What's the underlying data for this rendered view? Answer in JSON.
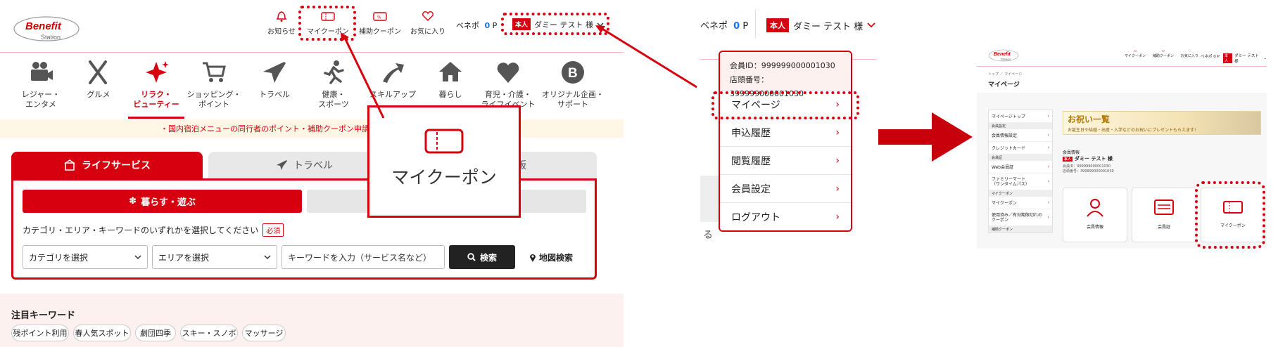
{
  "panel1": {
    "logo": {
      "line1": "Benefit",
      "line2": "Station"
    },
    "header_nav": [
      {
        "label": "お知らせ",
        "icon": "bell-icon"
      },
      {
        "label": "マイクーポン",
        "icon": "coupon-icon"
      },
      {
        "label": "補助クーポン",
        "icon": "subsidy-coupon-icon"
      },
      {
        "label": "お気に入り",
        "icon": "heart-icon"
      }
    ],
    "points_label": "ベネポ",
    "points_value": "0",
    "points_unit": "P",
    "user_badge": "本人",
    "user_name": "ダミー テスト 様",
    "categories": [
      {
        "label": "レジャー・\nエンタメ",
        "icon": "camera-icon"
      },
      {
        "label": "グルメ",
        "icon": "fork-knife-icon"
      },
      {
        "label": "リラク・\nビューティー",
        "icon": "sparkle-icon",
        "active": true
      },
      {
        "label": "ショッピング・\nポイント",
        "icon": "cart-icon"
      },
      {
        "label": "トラベル",
        "icon": "airplane-icon"
      },
      {
        "label": "健康・\nスポーツ",
        "icon": "runner-icon"
      },
      {
        "label": "スキルアップ",
        "icon": "arrow-up-icon"
      },
      {
        "label": "暮らし",
        "icon": "house-icon"
      },
      {
        "label": "育児・介護・\nライフイベント",
        "icon": "heart-fill-icon"
      },
      {
        "label": "オリジナル企画・\nサポート",
        "icon": "b-badge-icon"
      }
    ],
    "notice": "・国内宿泊メニューの同行者のポイント・補助クーポン申請締",
    "tabs": [
      {
        "label": "ライフサービス",
        "active": true
      },
      {
        "label": "トラベル"
      },
      {
        "label": "販"
      }
    ],
    "subtab_active": "暮らす・遊ぶ",
    "search_instruction": "カテゴリ・エリア・キーワードのいずれかを選択してください",
    "required_badge": "必須",
    "category_select": "カテゴリを選択",
    "area_select": "エリアを選択",
    "keyword_placeholder": "キーワードを入力（サービス名など）",
    "search_button": "検索",
    "map_search": "地図検索",
    "featured_title": "注目キーワード",
    "keywords": [
      "残ポイント利用",
      "春人気スポット",
      "劇団四季",
      "スキー・スノボ",
      "マッサージ"
    ],
    "zoom_label": "マイクーポン"
  },
  "panel2": {
    "points_label": "ベネポ",
    "points_value": "0",
    "points_unit": "P",
    "user_badge": "本人",
    "user_name": "ダミー テスト 様",
    "member_id": "会員ID：999999000001030",
    "store_number": "店頭番号：399999000001030",
    "menu": [
      "マイページ",
      "申込履歴",
      "閲覧履歴",
      "会員設定",
      "ログアウト"
    ],
    "partial_text": "る"
  },
  "panel3": {
    "logo": {
      "line1": "Benefit",
      "line2": "Station"
    },
    "header_nav": [
      "マイクーポン",
      "補助クーポン",
      "お気に入り"
    ],
    "points": "ベネポ 0 P",
    "user_badge": "本人",
    "user_name": "ダミー テスト 様",
    "breadcrumb": "トップ ／ マイページ",
    "title": "マイページ",
    "sidebar": [
      {
        "type": "item",
        "label": "マイページトップ"
      },
      {
        "type": "head",
        "label": "会員設定"
      },
      {
        "type": "item",
        "label": "会員情報設定"
      },
      {
        "type": "item",
        "label": "クレジットカード"
      },
      {
        "type": "head",
        "label": "会員証"
      },
      {
        "type": "item",
        "label": "Web会員証"
      },
      {
        "type": "item",
        "label": "ファミリーマート\n（ワンタイムパス）"
      },
      {
        "type": "head",
        "label": "マイクーポン"
      },
      {
        "type": "item",
        "label": "マイクーポン"
      },
      {
        "type": "item",
        "label": "使用済み／有効期限切れの\nクーポン"
      },
      {
        "type": "head",
        "label": "補助クーポン"
      }
    ],
    "banner_title": "お祝い一覧",
    "banner_sub": "お誕生日や結婚・出産・入学などのお祝いにプレゼントもらえます!",
    "member_info_label": "会員情報",
    "member_badge": "本人",
    "member_name": "ダミー テスト 様",
    "member_id": "会員ID：999999000001030",
    "store_number": "店頭番号：399999000001030",
    "cards": [
      "会員情報",
      "会員証",
      "マイクーポン"
    ]
  },
  "colors": {
    "accent": "#d7000f",
    "arrow": "#c8000c",
    "pink_bg": "#fdf1ef"
  }
}
